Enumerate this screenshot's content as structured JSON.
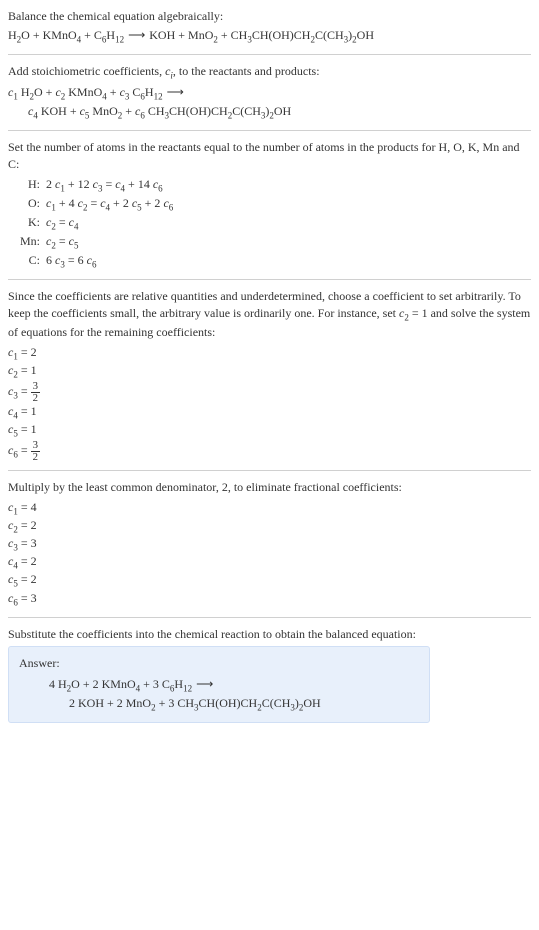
{
  "section1": {
    "title": "Balance the chemical equation algebraically:",
    "equation_left": "H",
    "eq": "H₂O + KMnO₄ + C₆H₁₂  ⟶  KOH + MnO₂ + CH₃CH(OH)CH₂C(CH₃)₂OH"
  },
  "section2": {
    "title_a": "Add stoichiometric coefficients, ",
    "ci": "cᵢ",
    "title_b": ", to the reactants and products:",
    "line1_a": "c₁ H₂O + c₂ KMnO₄ + c₃ C₆H₁₂  ⟶",
    "line2": "c₄ KOH + c₅ MnO₂ + c₆ CH₃CH(OH)CH₂C(CH₃)₂OH"
  },
  "section3": {
    "title": "Set the number of atoms in the reactants equal to the number of atoms in the products for H, O, K, Mn and C:",
    "rows": [
      {
        "label": "H:",
        "eq": "2 c₁ + 12 c₃ = c₄ + 14 c₆"
      },
      {
        "label": "O:",
        "eq": "c₁ + 4 c₂ = c₄ + 2 c₅ + 2 c₆"
      },
      {
        "label": "K:",
        "eq": "c₂ = c₄"
      },
      {
        "label": "Mn:",
        "eq": "c₂ = c₅"
      },
      {
        "label": "C:",
        "eq": "6 c₃ = 6 c₆"
      }
    ]
  },
  "section4": {
    "title": "Since the coefficients are relative quantities and underdetermined, choose a coefficient to set arbitrarily. To keep the coefficients small, the arbitrary value is ordinarily one. For instance, set c₂ = 1 and solve the system of equations for the remaining coefficients:",
    "coeffs": [
      {
        "text": "c₁ = 2",
        "frac": false
      },
      {
        "text": "c₂ = 1",
        "frac": false
      },
      {
        "text": "c₃ = ",
        "frac": true,
        "num": "3",
        "den": "2"
      },
      {
        "text": "c₄ = 1",
        "frac": false
      },
      {
        "text": "c₅ = 1",
        "frac": false
      },
      {
        "text": "c₆ = ",
        "frac": true,
        "num": "3",
        "den": "2"
      }
    ]
  },
  "section5": {
    "title": "Multiply by the least common denominator, 2, to eliminate fractional coefficients:",
    "coeffs": [
      "c₁ = 4",
      "c₂ = 2",
      "c₃ = 3",
      "c₄ = 2",
      "c₅ = 2",
      "c₆ = 3"
    ]
  },
  "section6": {
    "title": "Substitute the coefficients into the chemical reaction to obtain the balanced equation:",
    "answer_label": "Answer:",
    "answer_line1": "4 H₂O + 2 KMnO₄ + 3 C₆H₁₂  ⟶",
    "answer_line2": "2 KOH + 2 MnO₂ + 3 CH₃CH(OH)CH₂C(CH₃)₂OH"
  }
}
